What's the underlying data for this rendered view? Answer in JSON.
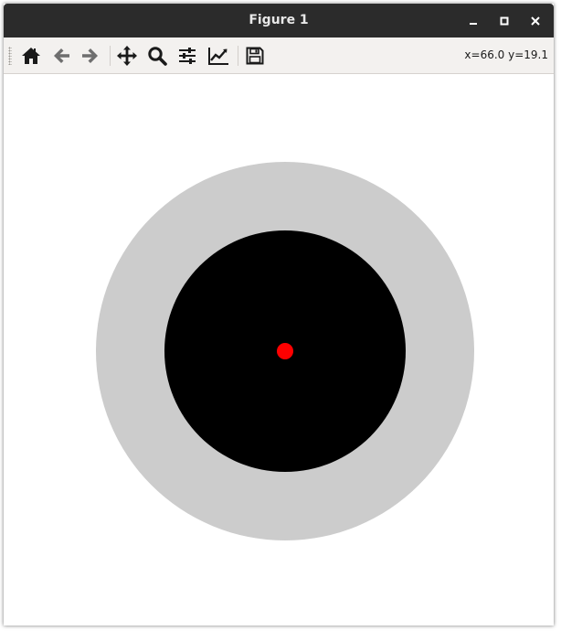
{
  "window": {
    "title": "Figure 1"
  },
  "toolbar": {
    "tools": [
      {
        "name": "home-icon"
      },
      {
        "name": "back-arrow-icon"
      },
      {
        "name": "forward-arrow-icon"
      },
      {
        "name": "pan-icon"
      },
      {
        "name": "zoom-icon"
      },
      {
        "name": "subplots-config-icon"
      },
      {
        "name": "edit-axis-icon"
      },
      {
        "name": "save-icon"
      }
    ],
    "coordinates": "x=66.0 y=19.1"
  },
  "colors": {
    "titlebar": "#2b2b2b",
    "toolbar": "#f3f1ef",
    "outer_ring": "#cccccc",
    "inner_disk": "#000000",
    "center_dot": "#ff0000"
  }
}
